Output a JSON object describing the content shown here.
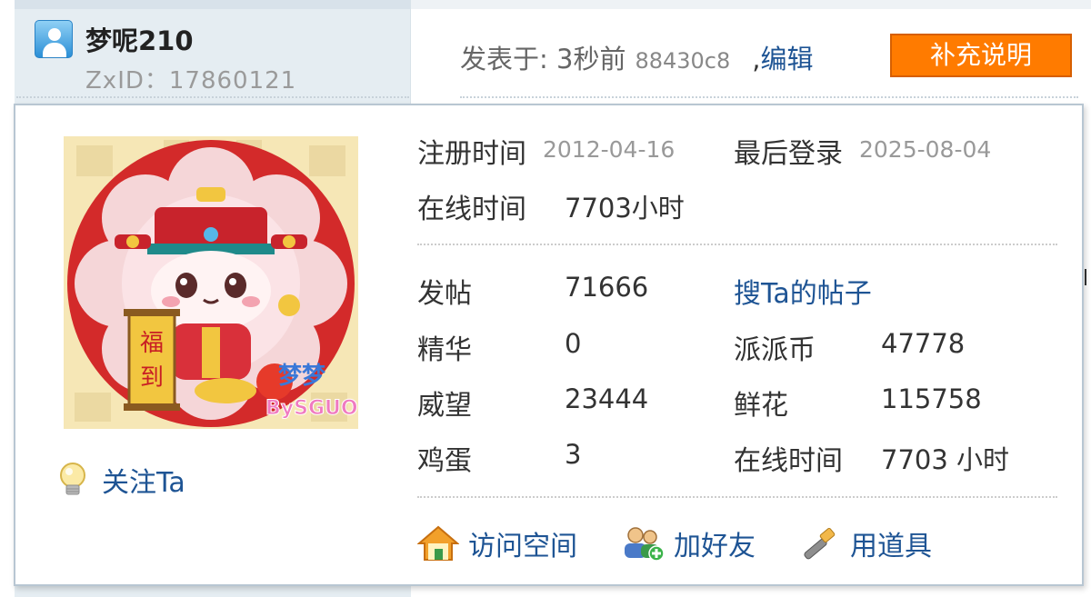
{
  "post": {
    "author_name": "梦呢210",
    "zxid_label": "ZxID：",
    "zxid_value": "17860121",
    "posted_label": "发表于: 3秒前",
    "post_hash": "88430c8",
    "comma": ",",
    "edit_link": "编辑",
    "supplement_button": "补充说明"
  },
  "card": {
    "register_label": "注册时间",
    "register_date": "2012-04-16",
    "last_login_label": "最后登录",
    "last_login_date": "2025-08-04",
    "online_label": "在线时间",
    "online_value": "7703小时",
    "stats": {
      "posts_label": "发帖",
      "posts_value": "71666",
      "search_posts_link": "搜Ta的帖子",
      "digest_label": "精华",
      "digest_value": "0",
      "coins_label": "派派币",
      "coins_value": "47778",
      "prestige_label": "威望",
      "prestige_value": "23444",
      "flowers_label": "鲜花",
      "flowers_value": "115758",
      "eggs_label": "鸡蛋",
      "eggs_value": "3",
      "online2_label": "在线时间",
      "online2_value": "7703 小时"
    },
    "follow_label": "关注Ta",
    "actions": {
      "visit_space": "访问空间",
      "add_friend": "加好友",
      "use_item": "用道具"
    },
    "avatar_text": {
      "scroll_text_1": "福",
      "scroll_text_2": "到",
      "badge_text": "梦梦",
      "signature": "BySGUO"
    }
  },
  "colors": {
    "link": "#1e5494",
    "supplement_button_bg": "#ff7b00",
    "avatar_red": "#d32a2a"
  },
  "icons": [
    "user-icon",
    "bulb-icon",
    "home-icon",
    "add-friend-icon",
    "tool-icon"
  ]
}
